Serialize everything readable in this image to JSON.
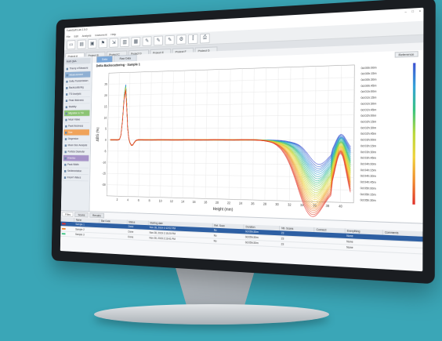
{
  "window": {
    "title": "TurbiSoft Lab 2.5.0",
    "menu": [
      "File",
      "Edit",
      "Analysis",
      "Instrument",
      "Help"
    ],
    "controls": [
      "–",
      "□",
      "×"
    ]
  },
  "toolbar": {
    "buttons": [
      {
        "name": "new-icon",
        "glyph": "▭"
      },
      {
        "name": "open-folder-icon",
        "glyph": "▤"
      },
      {
        "name": "save-icon",
        "glyph": "▣"
      },
      {
        "name": "bookmark-icon",
        "glyph": "⚑"
      },
      {
        "name": "export-icon",
        "glyph": "⇲"
      },
      {
        "name": "document-icon",
        "glyph": "▥"
      },
      {
        "name": "report-icon",
        "glyph": "▦"
      },
      {
        "name": "edit-icon",
        "glyph": "✎"
      },
      {
        "name": "edit-icon-2",
        "glyph": "✎"
      },
      {
        "name": "edit-icon-3",
        "glyph": "✎"
      },
      {
        "name": "settings-icon",
        "glyph": "⚙"
      },
      {
        "name": "pin-icon",
        "glyph": "⫿"
      },
      {
        "name": "print-icon",
        "glyph": "⎙"
      }
    ]
  },
  "project_tabs": [
    "Project A",
    "Project B",
    "Project C",
    "Project D",
    "Project E",
    "Project F",
    "Project G"
  ],
  "sidebar": {
    "header": "Multi Q&A",
    "items": [
      {
        "label": "Theory of Measure",
        "style": ""
      },
      {
        "label": "Measurement",
        "style": "blue"
      },
      {
        "label": "Delta Transmission",
        "style": ""
      },
      {
        "label": "Backscattering",
        "style": ""
      },
      {
        "label": "TSI Analysis",
        "style": ""
      },
      {
        "label": "Peak thickness",
        "style": ""
      },
      {
        "label": "Stability",
        "style": ""
      },
      {
        "label": "Migration & TSI",
        "style": "green"
      },
      {
        "label": "Mean Value",
        "style": ""
      },
      {
        "label": "Peak thickness",
        "style": ""
      },
      {
        "label": "Size",
        "style": "orange"
      },
      {
        "label": "Dispersion",
        "style": ""
      },
      {
        "label": "Mean Size Analysis",
        "style": ""
      },
      {
        "label": "Particle Diameter",
        "style": ""
      },
      {
        "label": "Kinetics",
        "style": "purple"
      },
      {
        "label": "Peak Width",
        "style": ""
      },
      {
        "label": "Sedimentation",
        "style": ""
      },
      {
        "label": "Export Values",
        "style": ""
      }
    ]
  },
  "view_tabs": [
    "Data",
    "Raw Data"
  ],
  "chart_header": {
    "title": "Delta Backscattering - Sample 1",
    "mode_button": "Reference"
  },
  "chart_data": {
    "type": "line",
    "title": "Delta Backscattering - Sample 1",
    "xlabel": "Height (mm)",
    "ylabel": "ΔBS (%)",
    "xlim": [
      0,
      42
    ],
    "ylim": [
      -25,
      30
    ],
    "curves": 28,
    "color_scale": [
      "#3b4fd1",
      "#2f9fd8",
      "#35c27f",
      "#b9d83a",
      "#f0d23a",
      "#f08a2c",
      "#e0302a"
    ],
    "legend_times": [
      "0d:00h:00m",
      "0d:00h:15m",
      "0d:00h:30m",
      "0d:00h:45m",
      "0d:01h:00m",
      "0d:01h:15m",
      "0d:01h:30m",
      "0d:01h:45m",
      "0d:02h:00m",
      "0d:02h:15m",
      "0d:02h:30m",
      "0d:02h:45m",
      "0d:03h:00m",
      "0d:03h:15m",
      "0d:03h:30m",
      "0d:03h:45m",
      "0d:04h:00m",
      "0d:04h:15m",
      "0d:04h:30m",
      "0d:04h:45m",
      "0d:05h:00m",
      "0d:05h:15m",
      "0d:05h:30m"
    ],
    "x_ticks": [
      2,
      4,
      6,
      8,
      10,
      12,
      14,
      16,
      18,
      20,
      22,
      24,
      26,
      28,
      30,
      32,
      34,
      36,
      38,
      40
    ],
    "y_ticks": [
      25,
      20,
      15,
      10,
      5,
      0,
      -5,
      -10,
      -15,
      -20
    ]
  },
  "bottom": {
    "tabs": [
      "Files",
      "Scans",
      "Results"
    ],
    "columns": [
      "",
      "Name",
      "Bar Code",
      "Status",
      "Starting date",
      "Ref. Scan",
      "Duration",
      "Nb. Scans",
      "Connect",
      "Everything",
      "Comments"
    ],
    "rows": [
      {
        "color": "#e0302a",
        "name": "Sample 1",
        "barcode": "",
        "status": "Done",
        "date": "Nov 28, 2019 2:12:02 PM",
        "ref": "No",
        "duration": "0d:05h:30m",
        "scans": "23",
        "connect": "",
        "all": "None",
        "comment": "",
        "selected": true
      },
      {
        "color": "#f08a2c",
        "name": "Sample 2",
        "barcode": "",
        "status": "Done",
        "date": "Nov 28, 2019 2:15:20 PM",
        "ref": "No",
        "duration": "0d:05h:30m",
        "scans": "23",
        "connect": "",
        "all": "None",
        "comment": "",
        "selected": false
      },
      {
        "color": "#35c27f",
        "name": "Sample 3",
        "barcode": "",
        "status": "Done",
        "date": "Nov 28, 2019 2:19:41 PM",
        "ref": "No",
        "duration": "0d:05h:30m",
        "scans": "23",
        "connect": "",
        "all": "None",
        "comment": "",
        "selected": false
      }
    ]
  }
}
